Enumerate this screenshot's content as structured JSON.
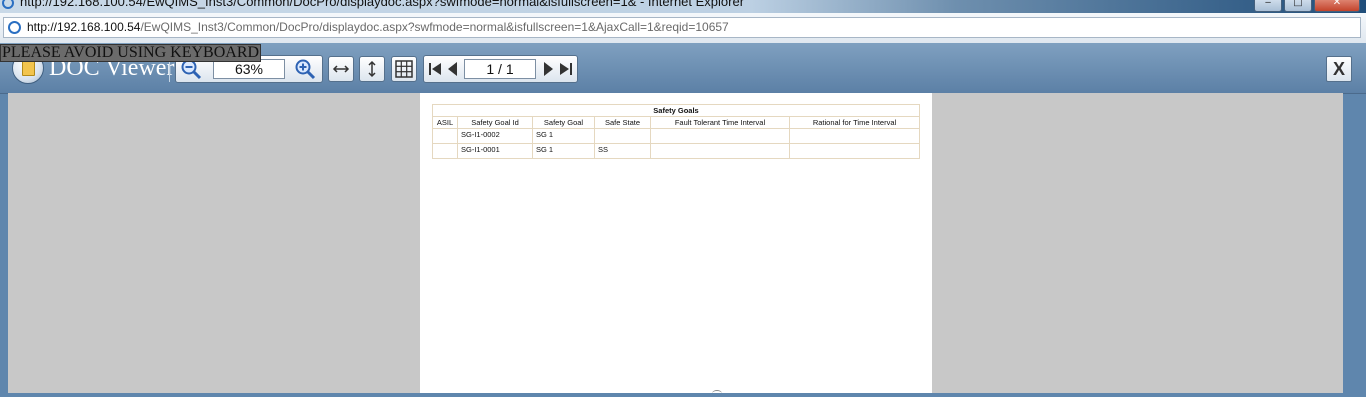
{
  "browser": {
    "title": "http://192.168.100.54/EwQIMS_Inst3/Common/DocPro/displaydoc.aspx?swfmode=normal&isfullscreen=1& - Internet Explorer",
    "url_host": "http://192.168.100.54",
    "url_path": "/EwQIMS_Inst3/Common/DocPro/displaydoc.aspx?swfmode=normal&isfullscreen=1&AjaxCall=1&reqid=10657"
  },
  "viewer": {
    "warning": "PLEASE AVOID USING KEYBOARD",
    "title": "DOC Viewer",
    "zoom": "63%",
    "page_indicator": "1 / 1",
    "close_label": "X"
  },
  "document": {
    "table_title": "Safety Goals",
    "columns": [
      "ASIL",
      "Safety Goal Id",
      "Safety Goal",
      "Safe State",
      "Fault Tolerant Time Interval",
      "Rational for Time Interval"
    ],
    "rows": [
      [
        "",
        "SG-I1-0002",
        "SG 1",
        "",
        "",
        ""
      ],
      [
        "",
        "SG-I1-0001",
        "SG 1",
        "SS",
        "",
        ""
      ]
    ]
  },
  "colors": {
    "toolbar": "#5f86ad",
    "background_gray": "#c8c8c8",
    "table_border": "#e5d8c0"
  }
}
